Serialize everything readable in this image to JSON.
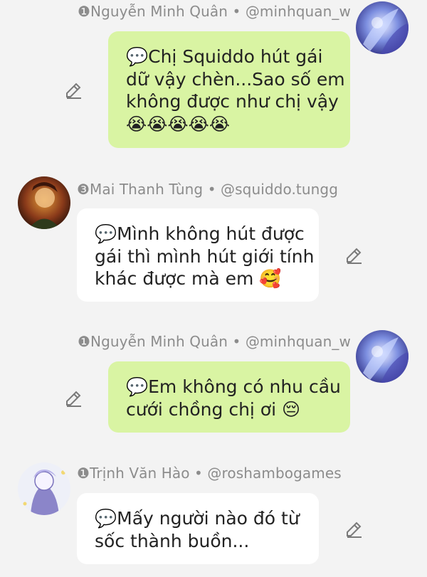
{
  "messages": [
    {
      "id": "m1",
      "direction": "out",
      "sender": "❶Nguyễn Minh Quân • @minhquan_w",
      "lines": [
        "💬Chị Squiddo hút gái",
        "dữ vậy chèn...Sao số em",
        "không được như chị vậy"
      ],
      "emojis": "😭😭😭😭😭"
    },
    {
      "id": "m2",
      "direction": "in",
      "sender": "❸Mai Thanh Tùng • @squiddo.tungg",
      "lines": [
        "💬Mình không hút được",
        "gái thì mình hút giới tính",
        "khác được mà em 🥰"
      ]
    },
    {
      "id": "m3",
      "direction": "out",
      "sender": "❶Nguyễn Minh Quân • @minhquan_w",
      "lines": [
        "💬Em không có nhu cầu",
        "cưới chồng chị ơi 😔"
      ]
    },
    {
      "id": "m4",
      "direction": "in",
      "sender": "❶Trịnh Văn Hào • @roshambogames",
      "lines": [
        "💬Mấy người nào đó từ",
        "sốc thành buồn..."
      ]
    }
  ],
  "icons": {
    "edit": "pencil-icon",
    "avatar": "avatar-image"
  },
  "colors": {
    "outgoing_bubble": "#d9f4a3",
    "incoming_bubble": "#ffffff",
    "background": "#f3f3f3",
    "header_text": "#8c8c8c"
  }
}
